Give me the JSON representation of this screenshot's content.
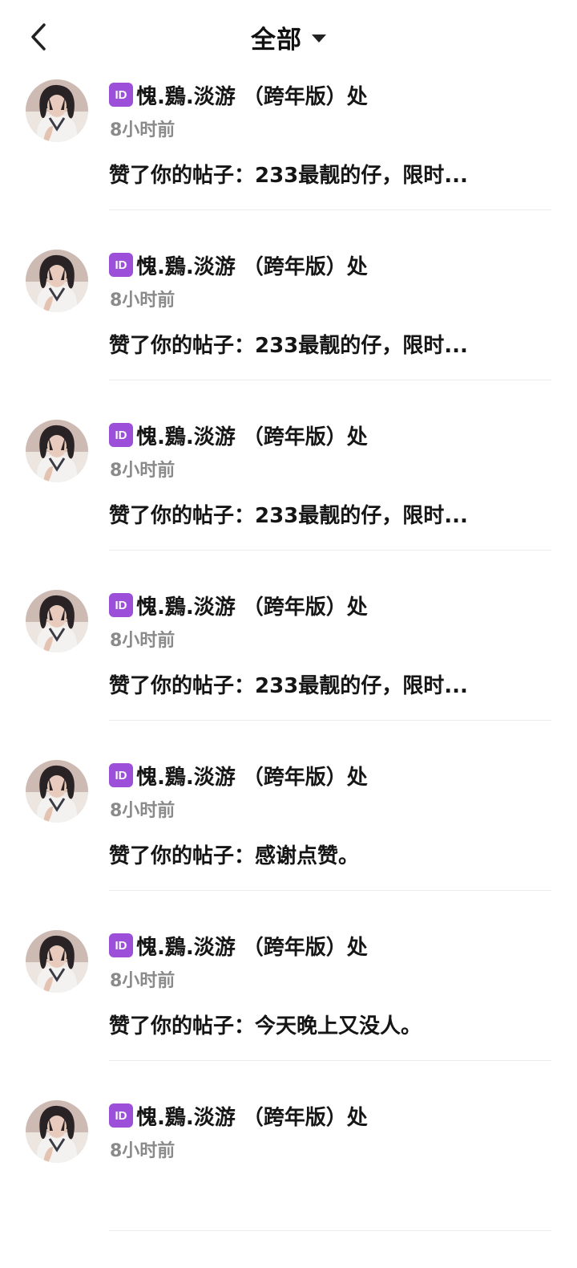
{
  "header": {
    "title": "全部"
  },
  "notifications": [
    {
      "badge": "ID",
      "name": "愧.鶢.淡游 （跨年版）处",
      "time": "8小时前",
      "content": "赞了你的帖子：233最靓的仔，限时..."
    },
    {
      "badge": "ID",
      "name": "愧.鶢.淡游 （跨年版）处",
      "time": "8小时前",
      "content": "赞了你的帖子：233最靓的仔，限时..."
    },
    {
      "badge": "ID",
      "name": "愧.鶢.淡游 （跨年版）处",
      "time": "8小时前",
      "content": "赞了你的帖子：233最靓的仔，限时..."
    },
    {
      "badge": "ID",
      "name": "愧.鶢.淡游 （跨年版）处",
      "time": "8小时前",
      "content": "赞了你的帖子：233最靓的仔，限时..."
    },
    {
      "badge": "ID",
      "name": "愧.鶢.淡游 （跨年版）处",
      "time": "8小时前",
      "content": "赞了你的帖子：感谢点赞。"
    },
    {
      "badge": "ID",
      "name": "愧.鶢.淡游 （跨年版）处",
      "time": "8小时前",
      "content": "赞了你的帖子：今天晚上又没人。"
    },
    {
      "badge": "ID",
      "name": "愧.鶢.淡游 （跨年版）处",
      "time": "8小时前",
      "content": ""
    }
  ],
  "colors": {
    "badge": "#9c4fd9",
    "time": "#8a8a8a",
    "divider": "#ececec"
  },
  "icons": {
    "back": "chevron-left-icon",
    "dropdown": "caret-down-icon"
  }
}
